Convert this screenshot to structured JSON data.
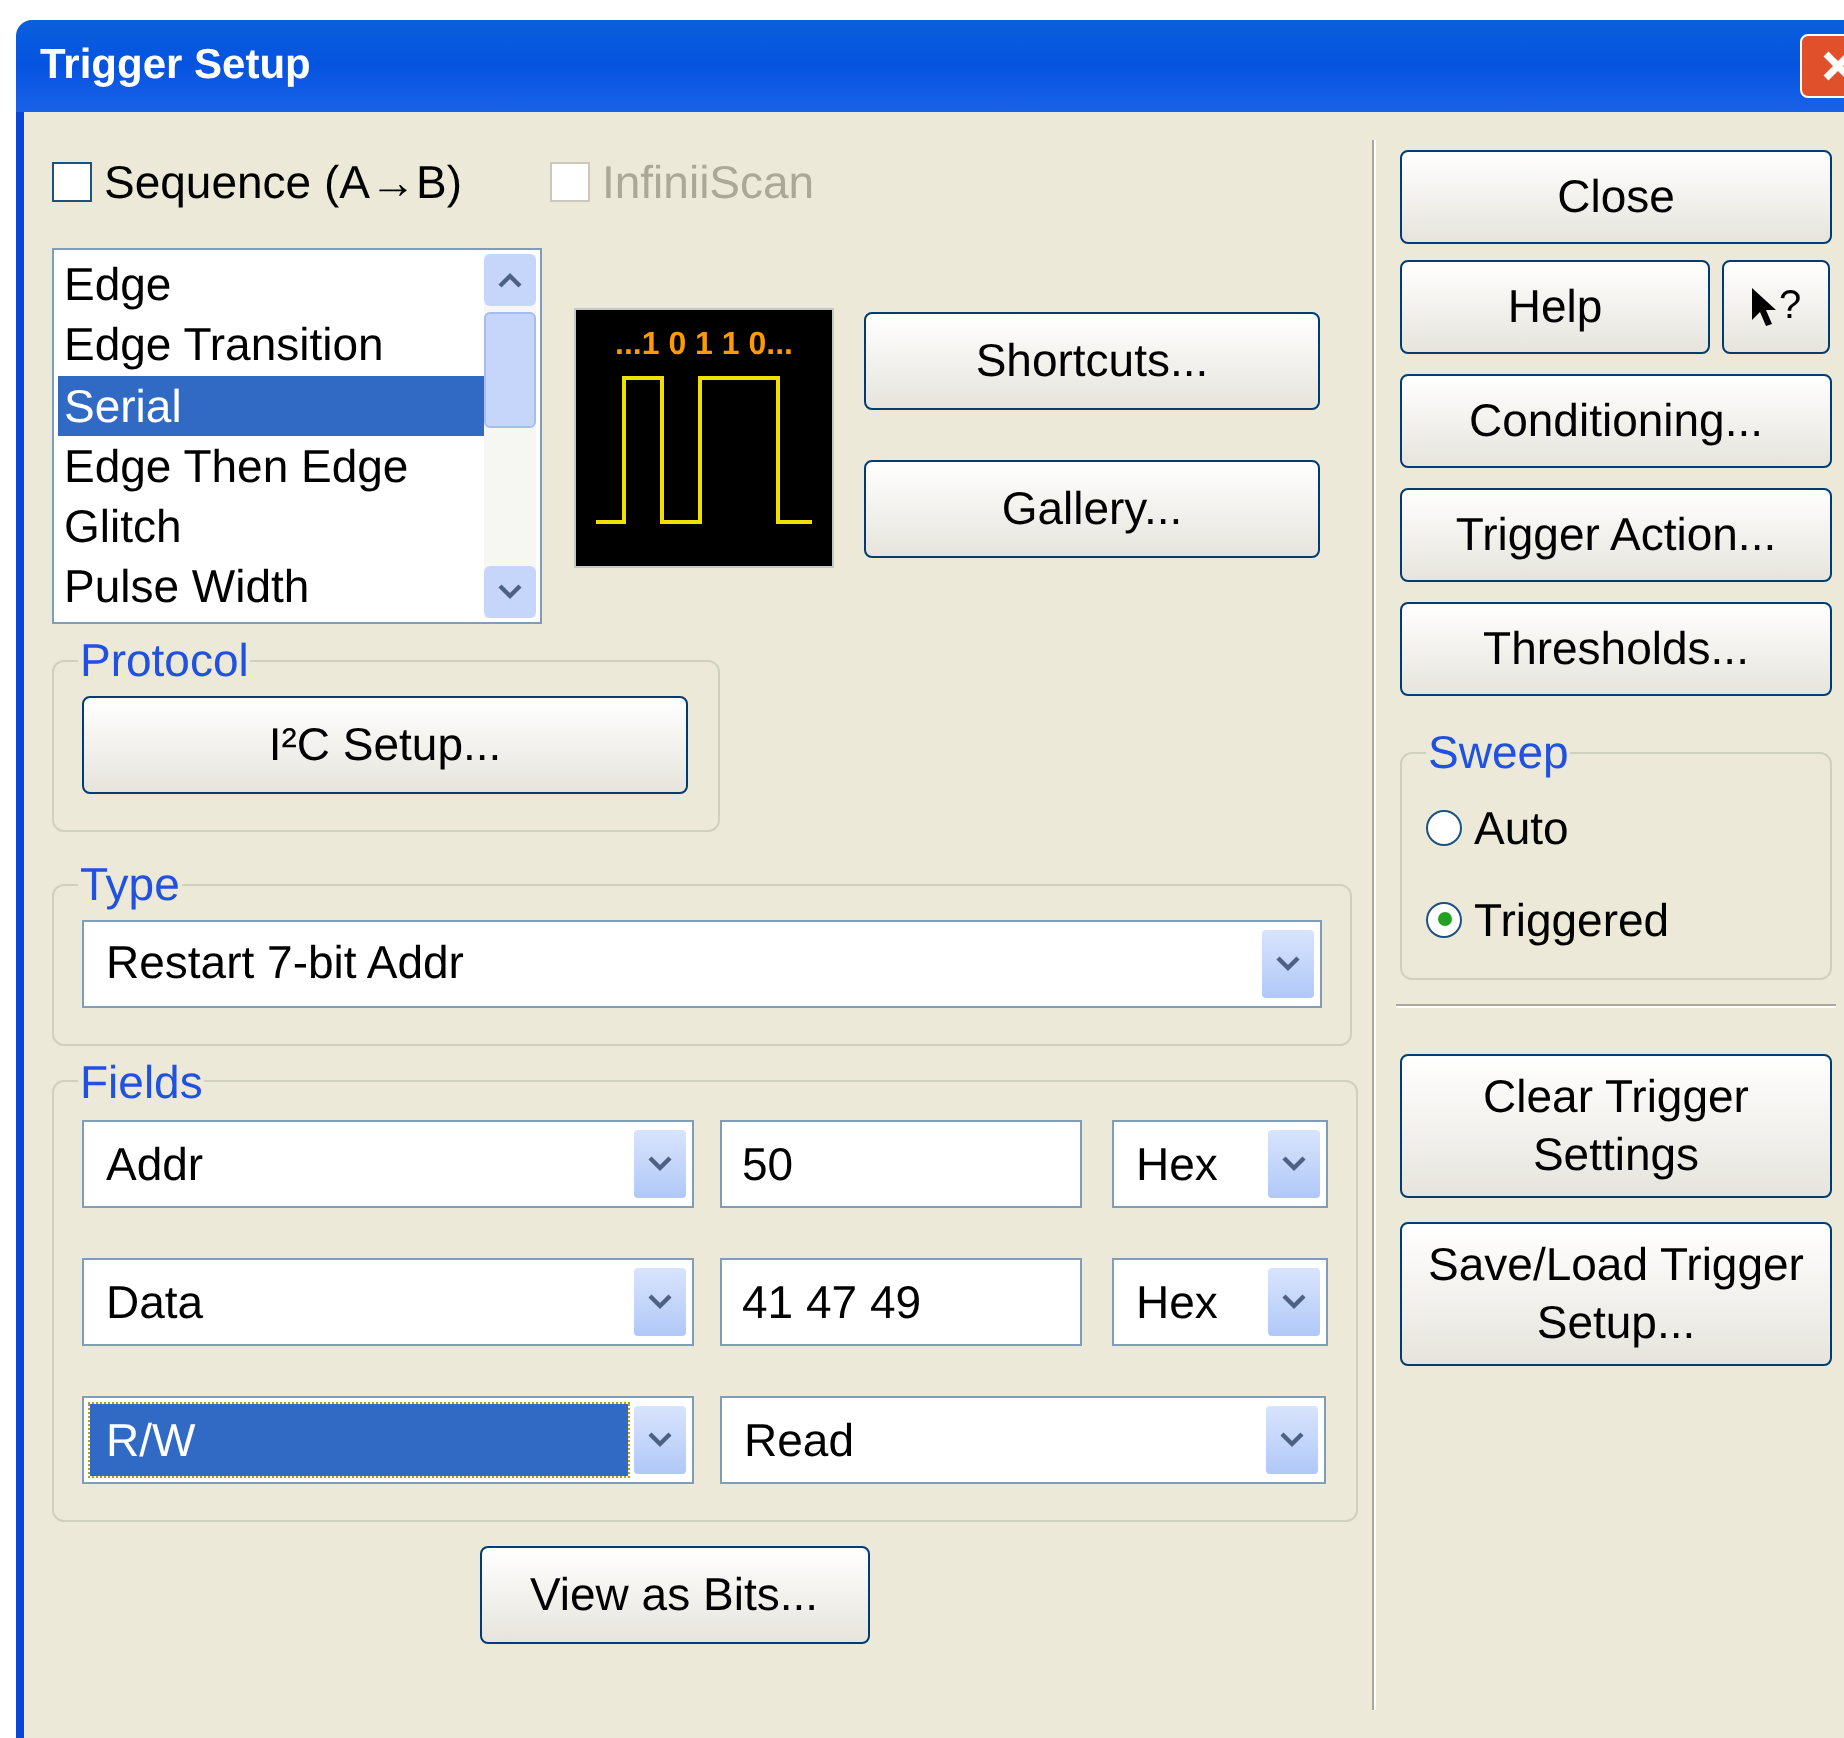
{
  "window": {
    "title": "Trigger Setup"
  },
  "sequence": {
    "label": "Sequence (A→B)",
    "checked": false,
    "disabled": false
  },
  "infiniiscan": {
    "label": "InfiniiScan",
    "checked": false,
    "disabled": true
  },
  "trigger_list": [
    {
      "label": "Edge",
      "selected": false
    },
    {
      "label": "Edge Transition",
      "selected": false
    },
    {
      "label": "Serial",
      "selected": true
    },
    {
      "label": "Edge Then Edge",
      "selected": false
    },
    {
      "label": "Glitch",
      "selected": false
    },
    {
      "label": "Pulse Width",
      "selected": false
    }
  ],
  "preview": {
    "bits": "...1 0 1 1 0..."
  },
  "mid_buttons": [
    "Shortcuts...",
    "Gallery..."
  ],
  "protocol": {
    "title": "Protocol",
    "button": "I²C Setup..."
  },
  "type": {
    "title": "Type",
    "value": "Restart 7-bit Addr"
  },
  "fields": {
    "title": "Fields",
    "rows": [
      {
        "kind": "value",
        "name": "Addr",
        "focused": false,
        "value": "50",
        "format": "Hex"
      },
      {
        "kind": "value",
        "name": "Data",
        "focused": false,
        "value": "41 47 49",
        "format": "Hex"
      },
      {
        "kind": "choice",
        "name": "R/W",
        "focused": true,
        "option": "Read"
      }
    ]
  },
  "view_bits": "View as Bits...",
  "close_button": "Close",
  "help_button": "Help",
  "whats_this": "?",
  "side_buttons": [
    "Conditioning...",
    "Trigger Action...",
    "Thresholds..."
  ],
  "sweep": {
    "title": "Sweep",
    "options": [
      {
        "label": "Auto",
        "selected": false
      },
      {
        "label": "Triggered",
        "selected": true
      }
    ]
  },
  "lower_buttons": [
    "Clear Trigger Settings",
    "Save/Load Trigger Setup..."
  ]
}
